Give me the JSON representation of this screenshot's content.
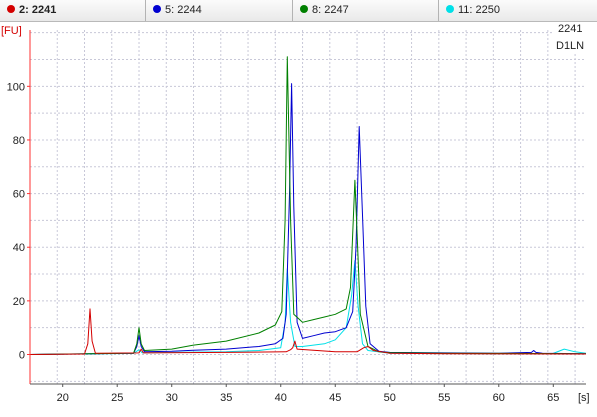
{
  "tabs": [
    {
      "label": "2: 2241",
      "color": "#d40000",
      "selected": true
    },
    {
      "label": "5: 2244",
      "color": "#0000d0",
      "selected": false
    },
    {
      "label": "8: 2247",
      "color": "#008000",
      "selected": false
    },
    {
      "label": "11: 2250",
      "color": "#00e0e8",
      "selected": false
    }
  ],
  "info_box": {
    "line1": "2241",
    "line2": "D1LN"
  },
  "chart_data": {
    "type": "line",
    "ylabel": "[FU]",
    "xlabel": "[s]",
    "xlim": [
      17,
      68
    ],
    "ylim": [
      -11,
      121
    ],
    "x_ticks": [
      20,
      25,
      30,
      35,
      40,
      45,
      50,
      55,
      60,
      65
    ],
    "y_ticks": [
      0,
      20,
      40,
      60,
      80,
      100
    ],
    "grid": true,
    "series": [
      {
        "name": "2: 2241",
        "color": "#d40000",
        "points": [
          [
            17,
            0
          ],
          [
            22,
            0.2
          ],
          [
            22.3,
            4
          ],
          [
            22.5,
            17
          ],
          [
            22.7,
            5
          ],
          [
            23,
            0.5
          ],
          [
            27,
            0.6
          ],
          [
            27.2,
            2
          ],
          [
            27.4,
            0.6
          ],
          [
            35,
            0.8
          ],
          [
            40.5,
            1
          ],
          [
            40.9,
            1.8
          ],
          [
            41.1,
            2.5
          ],
          [
            41.3,
            5
          ],
          [
            41.5,
            2
          ],
          [
            45,
            1
          ],
          [
            47,
            1
          ],
          [
            47.6,
            2.5
          ],
          [
            48,
            3
          ],
          [
            48.5,
            1.5
          ],
          [
            50,
            0.5
          ],
          [
            55,
            0.3
          ],
          [
            68,
            0.2
          ]
        ]
      },
      {
        "name": "5: 2244",
        "color": "#0000d0",
        "points": [
          [
            17,
            0
          ],
          [
            26.5,
            0.5
          ],
          [
            26.8,
            3
          ],
          [
            27,
            7
          ],
          [
            27.2,
            3
          ],
          [
            27.5,
            1
          ],
          [
            30,
            1.2
          ],
          [
            32,
            1.6
          ],
          [
            35,
            2
          ],
          [
            38,
            3
          ],
          [
            39.5,
            4
          ],
          [
            40.2,
            6
          ],
          [
            40.5,
            15
          ],
          [
            40.8,
            60
          ],
          [
            41,
            101
          ],
          [
            41.2,
            55
          ],
          [
            41.5,
            12
          ],
          [
            42,
            6
          ],
          [
            43,
            7
          ],
          [
            44,
            8
          ],
          [
            45,
            8.5
          ],
          [
            46,
            10
          ],
          [
            46.6,
            16
          ],
          [
            46.9,
            40
          ],
          [
            47.2,
            85
          ],
          [
            47.5,
            52
          ],
          [
            47.8,
            18
          ],
          [
            48.2,
            4
          ],
          [
            49,
            1.2
          ],
          [
            50,
            0.8
          ],
          [
            55,
            0.6
          ],
          [
            60,
            0.5
          ],
          [
            63,
            0.8
          ],
          [
            63.2,
            1.5
          ],
          [
            63.4,
            0.8
          ],
          [
            64,
            0.5
          ],
          [
            68,
            0.3
          ]
        ]
      },
      {
        "name": "8: 2247",
        "color": "#008000",
        "points": [
          [
            17,
            0
          ],
          [
            26.5,
            0.5
          ],
          [
            26.8,
            4
          ],
          [
            27,
            10
          ],
          [
            27.2,
            4
          ],
          [
            27.5,
            1.5
          ],
          [
            30,
            2
          ],
          [
            32,
            3.5
          ],
          [
            35,
            5
          ],
          [
            38,
            8
          ],
          [
            39.5,
            11
          ],
          [
            40.1,
            16
          ],
          [
            40.4,
            50
          ],
          [
            40.6,
            111
          ],
          [
            40.9,
            50
          ],
          [
            41.2,
            15
          ],
          [
            42,
            12
          ],
          [
            43,
            13
          ],
          [
            44,
            14
          ],
          [
            45,
            15
          ],
          [
            46,
            17
          ],
          [
            46.4,
            25
          ],
          [
            46.8,
            65
          ],
          [
            47,
            45
          ],
          [
            47.3,
            15
          ],
          [
            48,
            3
          ],
          [
            49,
            1
          ],
          [
            50,
            0.7
          ],
          [
            55,
            0.5
          ],
          [
            68,
            0.3
          ]
        ]
      },
      {
        "name": "11: 2250",
        "color": "#00e0e8",
        "points": [
          [
            17,
            0
          ],
          [
            26.5,
            0.4
          ],
          [
            27,
            1.8
          ],
          [
            27.3,
            0.6
          ],
          [
            30,
            0.8
          ],
          [
            35,
            1
          ],
          [
            38,
            1.5
          ],
          [
            40,
            2.5
          ],
          [
            40.4,
            12
          ],
          [
            40.6,
            32
          ],
          [
            40.9,
            12
          ],
          [
            41.3,
            3
          ],
          [
            42,
            3
          ],
          [
            44,
            4
          ],
          [
            45,
            5.5
          ],
          [
            46,
            10
          ],
          [
            46.5,
            22
          ],
          [
            46.8,
            35
          ],
          [
            47.1,
            18
          ],
          [
            47.5,
            4
          ],
          [
            48,
            1.5
          ],
          [
            50,
            0.5
          ],
          [
            55,
            0.4
          ],
          [
            60,
            0.3
          ],
          [
            65,
            0.4
          ],
          [
            66,
            2
          ],
          [
            67,
            1
          ],
          [
            68,
            0.5
          ]
        ]
      }
    ]
  }
}
